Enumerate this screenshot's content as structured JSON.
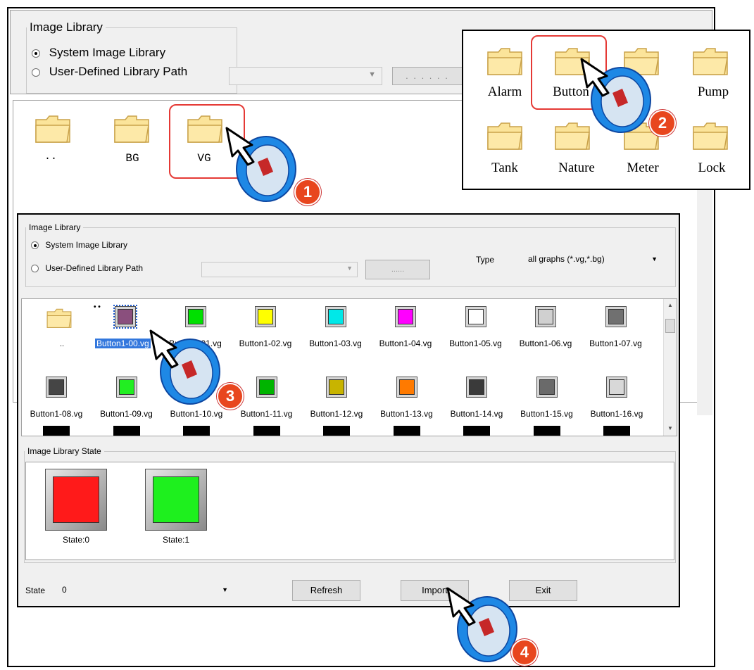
{
  "back_window": {
    "group_title": "Image Library",
    "radio_system": "System Image Library",
    "radio_user": "User-Defined Library Path",
    "browse_label": ". . . . . .",
    "folders": [
      "..",
      "BG",
      "VG"
    ]
  },
  "popup_folders": [
    "Alarm",
    "Button",
    "Pump",
    "Tank",
    "Nature",
    "Meter",
    "Lock"
  ],
  "dialog": {
    "group_title": "Image Library",
    "radio_system": "System Image Library",
    "radio_user": "User-Defined Library Path",
    "browse_label": "......",
    "type_label": "Type",
    "type_value": "all graphs (*.vg,*.bg)",
    "up_label": "..",
    "up_dots": "• •",
    "files_row1": [
      "Button1-00.vg",
      "Button1-01.vg",
      "Button1-02.vg",
      "Button1-03.vg",
      "Button1-04.vg",
      "Button1-05.vg",
      "Button1-06.vg",
      "Button1-07.vg"
    ],
    "files_row2": [
      "Button1-08.vg",
      "Button1-09.vg",
      "Button1-10.vg",
      "Button1-11.vg",
      "Button1-12.vg",
      "Button1-13.vg",
      "Button1-14.vg",
      "Button1-15.vg",
      "Button1-16.vg"
    ],
    "colors_row1": [
      "#8a4f7d",
      "#00e000",
      "#ffff00",
      "#00e8e8",
      "#ff00ff",
      "#ffffff",
      "#d0d0d0",
      "#707070"
    ],
    "colors_row2": [
      "#454545",
      "#22ee22",
      "#0000ff",
      "#00b400",
      "#c8b400",
      "#ff7a00",
      "#3a3a3a",
      "#6a6a6a",
      "#d8d8d8"
    ],
    "state_group_title": "Image Library State",
    "states": [
      {
        "label": "State:0",
        "color": "#ff1a1a"
      },
      {
        "label": "State:1",
        "color": "#1ef01e"
      }
    ],
    "state_label": "State",
    "state_value": "0",
    "refresh": "Refresh",
    "import": "Import",
    "exit": "Exit"
  },
  "steps": [
    "1",
    "2",
    "3",
    "4"
  ]
}
